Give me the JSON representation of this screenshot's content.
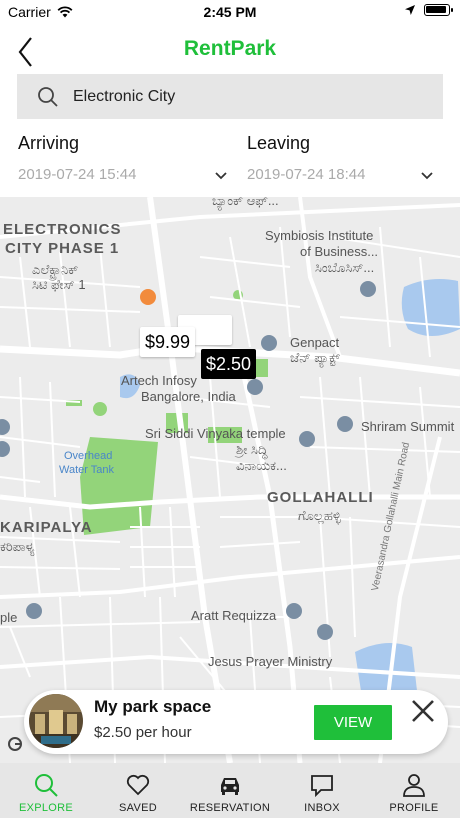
{
  "status_bar": {
    "carrier": "Carrier",
    "time": "2:45 PM"
  },
  "nav": {
    "title": "RentPark"
  },
  "search": {
    "value": "Electronic City"
  },
  "arriving": {
    "label": "Arriving",
    "value": "2019-07-24 15:44"
  },
  "leaving": {
    "label": "Leaving",
    "value": "2019-07-24 18:44"
  },
  "map": {
    "areas": [
      "ELECTRONICS",
      "CITY PHASE 1",
      "GOLLAHALLI",
      "KARIPALYA"
    ],
    "local_labels": [
      "ಎಲೆಕ್ಟ್ರಾನಿಕ್",
      "ಸಿಟಿ ಫೇಸ್ 1",
      "ಗೊಲ್ಲಹಳ್ಳಿ",
      "ಕರಿಪಾಳ್ಯ",
      "ಬ್ಯಾಂಕ್ ಆಫ್..."
    ],
    "places": {
      "symbiosis": [
        "Symbiosis Institute",
        "of Business...",
        "ಸಿಂಬೊಸಿಸ್..."
      ],
      "genpact": [
        "Genpact",
        "ಜೆನ್ ಪ್ಯಾಕ್ಟ್"
      ],
      "artech": [
        "Artech Infosy",
        "Bangalore, India"
      ],
      "siddi": [
        "Sri Siddi Vinyaka temple",
        "ಶ್ರೀ ಸಿದ್ಧಿ",
        "ವಿನಾಯಕ..."
      ],
      "shriram": "Shriram Summit",
      "aratt": "Aratt Requizza",
      "jesus": "Jesus Prayer Ministry",
      "ple": "ple"
    },
    "water_labels": [
      "Overhead",
      "Water Tank"
    ],
    "road_label": "Veerasandra Gollahalli Main Road",
    "pins": [
      {
        "label": "$9.99",
        "selected": false
      },
      {
        "label": "$2.50",
        "selected": true
      }
    ],
    "colors": {
      "land": "#ececec",
      "roads": "#ffffff",
      "parks": "#93d47a",
      "water": "#a9c9ee",
      "pin_selected_bg": "#000000"
    }
  },
  "card": {
    "title": "My park space",
    "price": "$2.50 per hour",
    "view_label": "VIEW"
  },
  "tabs": [
    {
      "id": "explore",
      "label": "EXPLORE",
      "icon": "search-icon",
      "active": true
    },
    {
      "id": "saved",
      "label": "SAVED",
      "icon": "heart-icon",
      "active": false
    },
    {
      "id": "reservation",
      "label": "RESERVATION",
      "icon": "car-icon",
      "active": false
    },
    {
      "id": "inbox",
      "label": "INBOX",
      "icon": "chat-bubble-icon",
      "active": false
    },
    {
      "id": "profile",
      "label": "PROFILE",
      "icon": "user-icon",
      "active": false
    }
  ],
  "colors": {
    "accent": "#1fbf3a",
    "search_bg": "#e6e6e6",
    "tabbar_bg": "#e6e6e6"
  }
}
